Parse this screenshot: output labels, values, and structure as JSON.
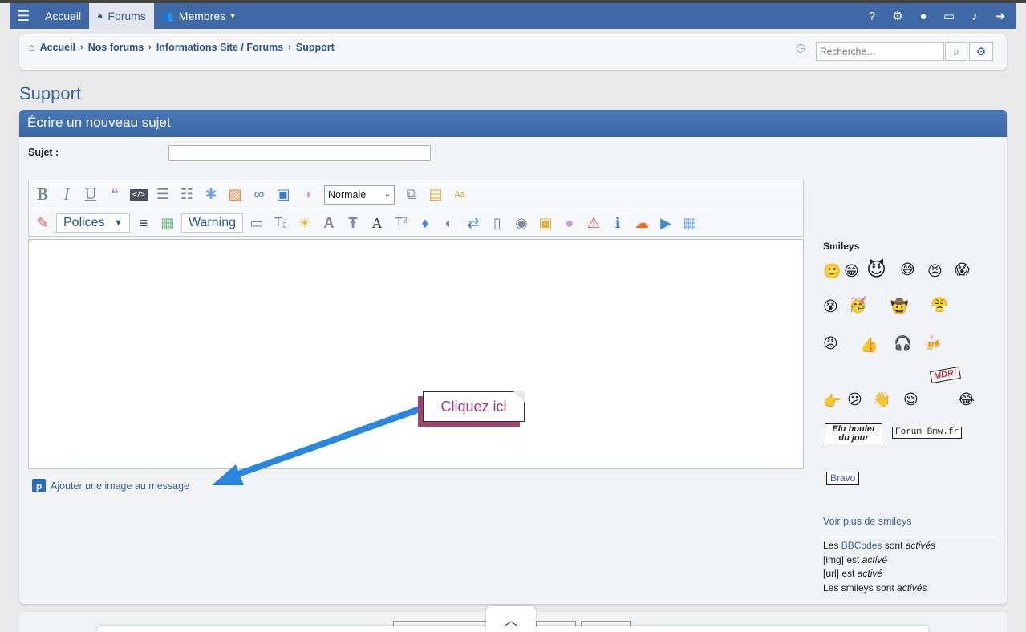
{
  "nav": {
    "home": "Accueil",
    "forums": "Forums",
    "members": "Membres"
  },
  "breadcrumbs": [
    "Accueil",
    "Nos forums",
    "Informations Site / Forums",
    "Support"
  ],
  "search": {
    "placeholder": "Recherche…"
  },
  "page_title": "Support",
  "form": {
    "header": "Écrire un nouveau sujet",
    "subject_label": "Sujet :"
  },
  "toolbar": {
    "size_select": "Normale",
    "fonts_button": "Polices",
    "warning_button": "Warning"
  },
  "callout": "Cliquez ici",
  "add_image": "Ajouter une image au message",
  "smileys": {
    "title": "Smileys",
    "sign_elu_line1": "Elu boulet",
    "sign_elu_line2": "du jour",
    "sign_forum": "Forum Bmw.fr",
    "sign_bravo": "Bravo",
    "sign_mdr": "MDR!",
    "more": "Voir plus de smileys"
  },
  "bbcode_info": {
    "l1_prefix": "Les ",
    "l1_link": "BBCodes",
    "l1_mid": " sont ",
    "l1_state": "activés",
    "l2_prefix": "[img] est ",
    "l2_state": "activé",
    "l3_prefix": "[url] est ",
    "l3_state": "activé",
    "l4_prefix": "Les smileys sont ",
    "l4_state": "activés"
  },
  "colors": {
    "navbar": "#3e69a6",
    "accent_link": "#3a67a0",
    "callout_text": "#a0397a",
    "arrow": "#2a86e0"
  }
}
